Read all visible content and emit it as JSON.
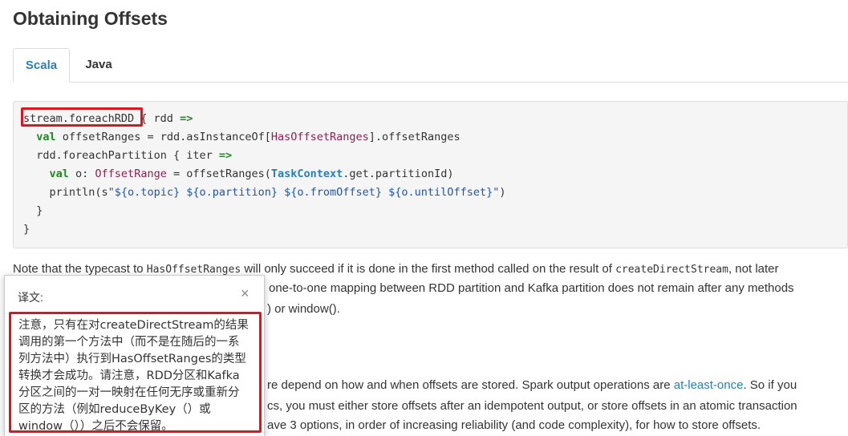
{
  "heading": "Obtaining Offsets",
  "tabs": [
    {
      "label": "Scala",
      "active": true
    },
    {
      "label": "Java",
      "active": false
    }
  ],
  "code": {
    "l1_a": "stream.foreachRDD",
    "l1_b": " { rdd ",
    "l1_c": "=>",
    "l2_kw": "val",
    "l2_a": " offsetRanges = rdd.asInstanceOf[",
    "l2_ty": "HasOffsetRanges",
    "l2_b": "].offsetRanges",
    "l3_a": "rdd.foreachPartition { iter ",
    "l3_b": "=>",
    "l4_kw": "val",
    "l4_a": " o: ",
    "l4_ty": "OffsetRange",
    "l4_b": " = offsetRanges(",
    "l4_tyb": "TaskContext",
    "l4_c": ".get.partitionId)",
    "l5_a": "println(s",
    "l5_str": "\"${o.topic} ${o.partition} ${o.fromOffset} ${o.untilOffset}\"",
    "l5_b": ")",
    "l6": "}",
    "l7": "}"
  },
  "paragraph1": {
    "a": "Note that the typecast to ",
    "code1": "HasOffsetRanges",
    "b": " will only succeed if it is done in the first method called on the result of ",
    "code2": "createDirectStream",
    "c": ", not later",
    "line2": "one-to-one mapping between RDD partition and Kafka partition does not remain after any methods",
    "line3": ") or window()."
  },
  "paragraph2": {
    "line1_a": "re depend on how and when offsets are stored. Spark output operations are ",
    "line1_link": "at-least-once",
    "line1_b": ". So if you",
    "line2": "cs, you must either store offsets after an idempotent output, or store offsets in an atomic transaction",
    "line3": "ave 3 options, in order of increasing reliability (and code complexity), for how to store offsets."
  },
  "translation_popup": {
    "title": "译文:",
    "close_icon": "×",
    "lines": [
      "注意，只有在对createDirectStream的结果",
      "调用的第一个方法中（而不是在随后的一系",
      "列方法中）执行到HasOffsetRanges的类型",
      "转换才会成功。请注意，RDD分区和Kafka",
      "分区之间的一对一映射在任何无序或重新分",
      "区的方法（例如reduceByKey（）或",
      "window（））之后不会保留。"
    ]
  },
  "colors": {
    "accent": "#2a7fb5",
    "highlight": "#e0141e",
    "keyword": "#228822"
  }
}
